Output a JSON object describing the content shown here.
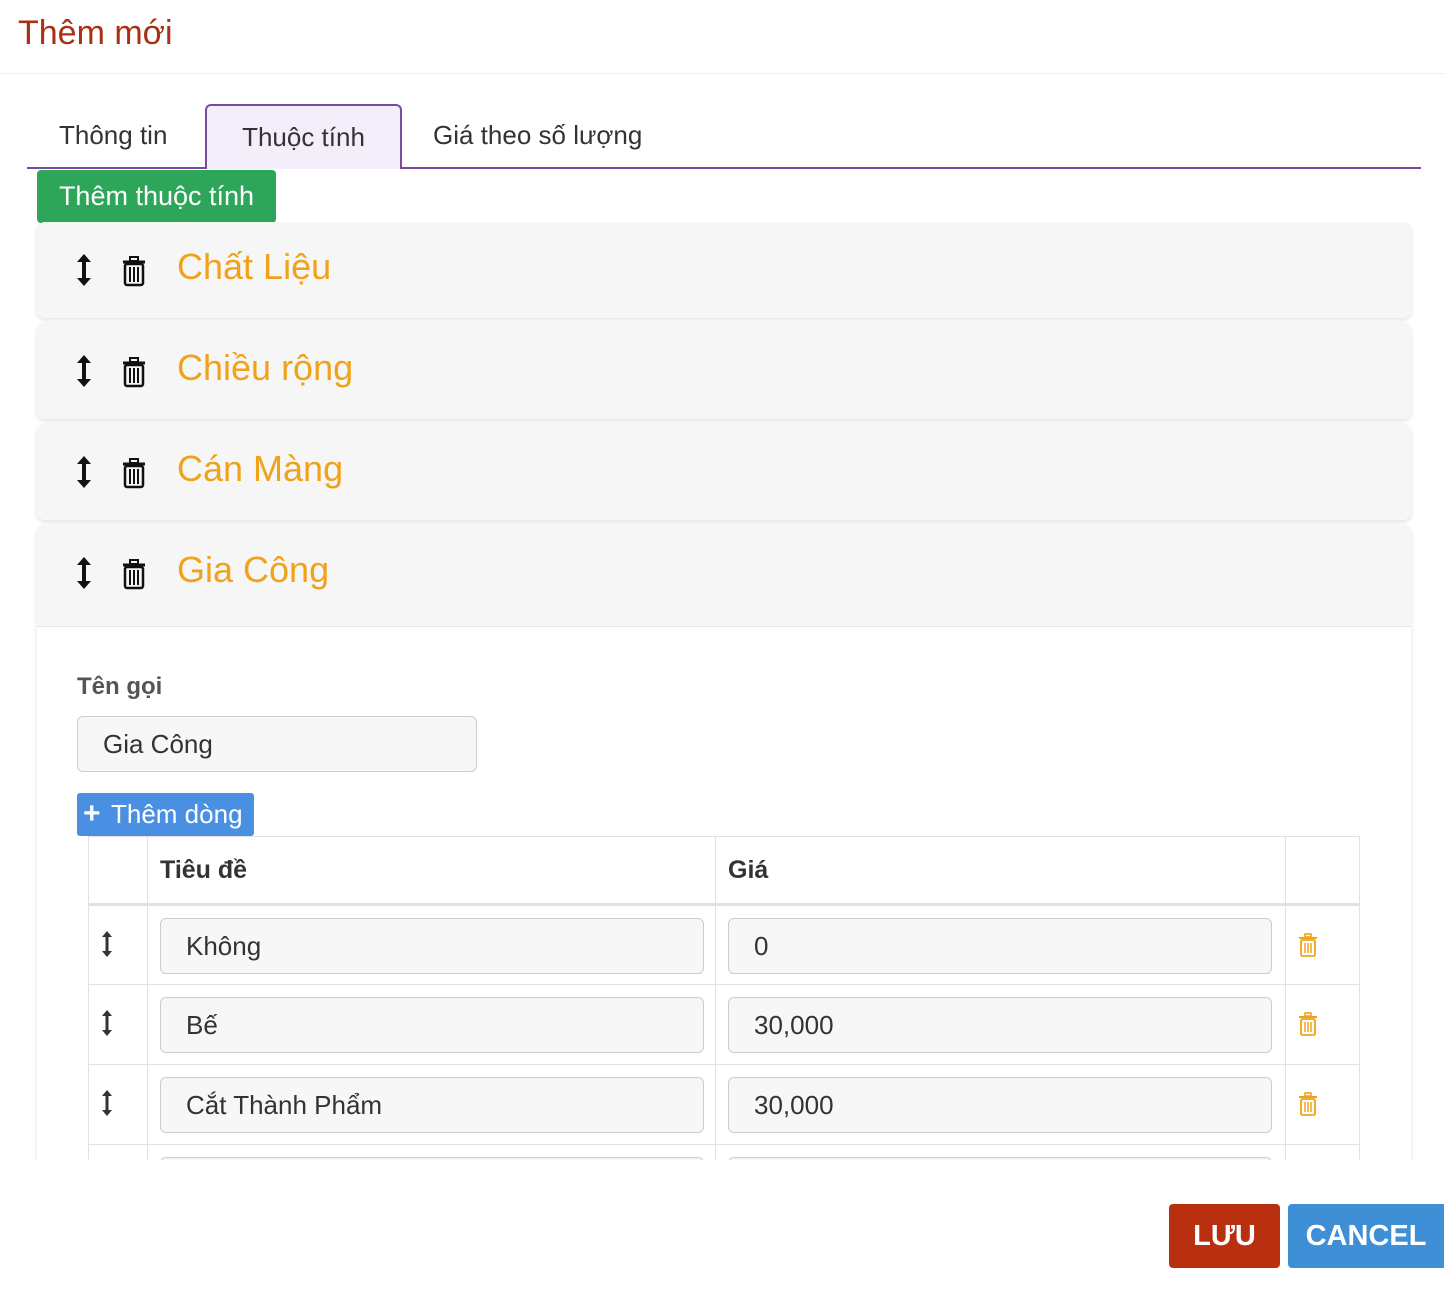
{
  "header": {
    "title": "Thêm mới"
  },
  "tabs": [
    {
      "label": "Thông tin"
    },
    {
      "label": "Thuộc tính"
    },
    {
      "label": "Giá theo số lượng"
    }
  ],
  "active_tab": "Thuộc tính",
  "add_attribute_label": "Thêm thuộc tính",
  "attributes": [
    {
      "title": "Chất Liệu"
    },
    {
      "title": "Chiều rộng"
    },
    {
      "title": "Cán Màng"
    },
    {
      "title": "Gia Công"
    }
  ],
  "expanded": {
    "name_label": "Tên gọi",
    "name_value": "Gia Công",
    "add_row_label": "Thêm dòng",
    "columns": {
      "title": "Tiêu đề",
      "price": "Giá"
    },
    "rows": [
      {
        "title": "Không",
        "price": "0"
      },
      {
        "title": "Bế",
        "price": "30,000"
      },
      {
        "title": "Cắt Thành Phẩm",
        "price": "30,000"
      }
    ]
  },
  "footer": {
    "save_label": "LƯU",
    "cancel_label": "CANCEL"
  },
  "colors": {
    "title": "#a93015",
    "attribute_title": "#f0a21a",
    "tab_border": "#7a4aa0",
    "add_attribute": "#2ea65a",
    "add_row": "#4a90e2",
    "save": "#b93010",
    "cancel": "#3f8fd6"
  },
  "icons": {
    "sort": "updown-arrow-icon",
    "delete": "trash-icon"
  }
}
